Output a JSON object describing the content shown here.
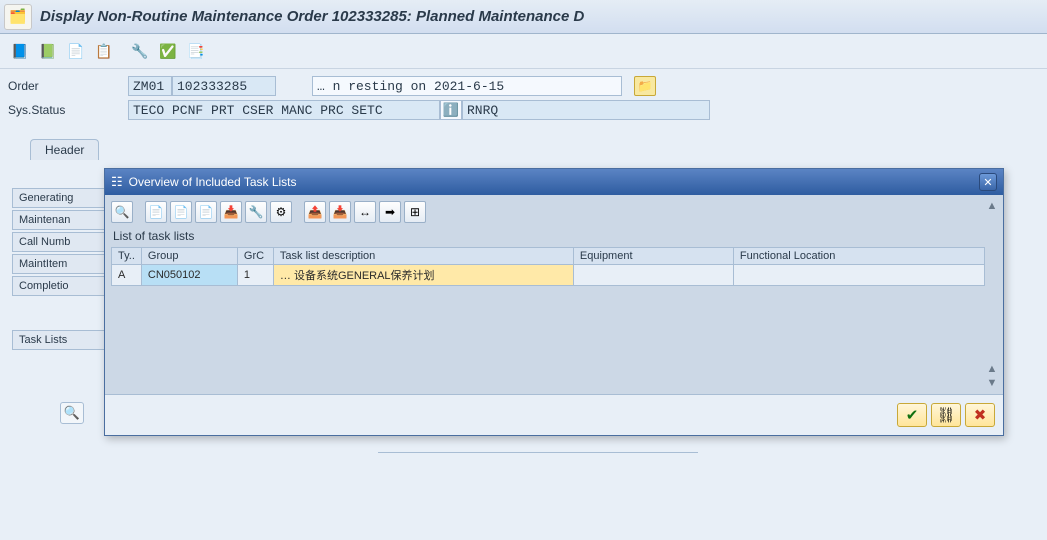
{
  "titlebar": {
    "app_icon": "🗂️",
    "title": "Display Non-Routine Maintenance Order 102333285: Planned Maintenance D"
  },
  "toolbar": {
    "btn1": "📘",
    "btn2": "📗",
    "btn3": "📄",
    "btn4": "📋",
    "btn5": "🔧",
    "btn6": "✅",
    "btn7": "📑"
  },
  "form": {
    "order_label": "Order",
    "order_type": "ZM01",
    "order_number": "102333285",
    "order_desc": "… n resting on 2021-6-15",
    "folder_icon": "📁",
    "sysstatus_label": "Sys.Status",
    "sysstatus_value": "TECO PCNF PRT  CSER MANC PRC  SETC",
    "info_icon": "ℹ️",
    "sysstatus_extra": "RNRQ"
  },
  "tabs": {
    "header": "Header"
  },
  "side_panels": {
    "generating": "Generating",
    "maintenance": "Maintenan",
    "callnum": "Call Numb",
    "maintitem": "MaintItem",
    "completion": "Completio",
    "tasklists": "Task Lists"
  },
  "bottom_icon": "🔍",
  "dialog": {
    "title": "Overview of Included Task Lists",
    "icon": "☷",
    "close": "✕",
    "toolbar_icons": [
      "🔍",
      "📄",
      "📄",
      "📄",
      "📥",
      "🔧",
      "⚙",
      "📤",
      "📥",
      "↔",
      "➡",
      "⊞"
    ],
    "section_label": "List of task lists",
    "columns": {
      "ty": "Ty..",
      "group": "Group",
      "grc": "GrC",
      "desc": "Task list description",
      "equip": "Equipment",
      "floc": "Functional Location"
    },
    "row": {
      "ty": "A",
      "group": "CN050102",
      "grc": "1",
      "desc": "… 设备系统GENERAL保养计划",
      "equip": "",
      "floc": ""
    },
    "footer": {
      "ok": "✔",
      "chain": "⛓",
      "cancel": "✖"
    }
  }
}
